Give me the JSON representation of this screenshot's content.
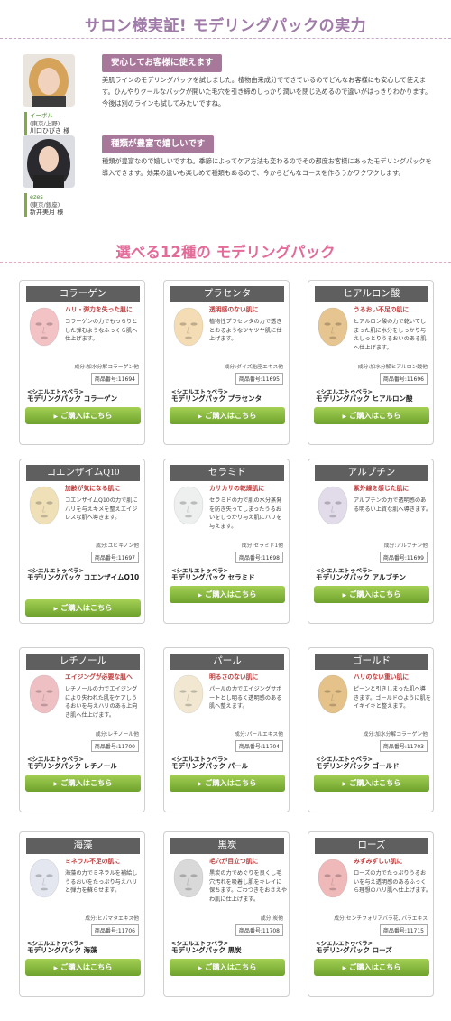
{
  "section_title": "サロン様実証! モデリングパックの実力",
  "reviews": [
    {
      "shop": "イーボル",
      "location": "(東京/上野)",
      "name": "川口ひびき",
      "honorific": "様",
      "tag": "安心してお客様に使えます",
      "text": "美肌ラインのモデリングパックを試しました。植物由来成分でできているのでどんなお客様にも安心して使えます。ひんやりクールなパックが開いた毛穴を引き締めしっかり潤いを閉じ込めるので違いがはっきりわかります。今後は別のラインも試してみたいですね。"
    },
    {
      "shop": "ezes",
      "location": "(東京/銀座)",
      "name": "新井美月",
      "honorific": "様",
      "tag": "種類が豊富で嬉しいです",
      "text": "種類が豊富なので嬉しいですね。季節によってケア方法も変わるのでその都度お客様にあったモデリングパックを導入できます。効果の違いも楽しめて種類もあるので、今からどんなコースを作ろうかワクワクします。"
    }
  ],
  "products_title": "選べる12種の モデリングパック",
  "brand_label": "<シエルエトゥベラ>",
  "buy_label": "ご購入はこちら",
  "products": [
    {
      "name": "コラーゲン",
      "tag": "ハリ・弾力を失った肌に",
      "desc": "コラーゲンの力でもっちりとした弾むようなふっくら肌へ仕上げます。",
      "ingredient": "成分:加水分解コラーゲン他",
      "number": "商品番号:11694",
      "fullname": "モデリングパック コラーゲン",
      "color": "#f2c2c5"
    },
    {
      "name": "プラセンタ",
      "tag": "透明感のない肌に",
      "desc": "植物性プラセンタの力で透きとおるようなツヤツヤ肌に仕上げます。",
      "ingredient": "成分:ダイズ胎座エキス他",
      "number": "商品番号:11695",
      "fullname": "モデリングパック プラセンタ",
      "color": "#f4dcb4"
    },
    {
      "name": "ヒアルロン酸",
      "tag": "うるおい不足の肌に",
      "desc": "ヒアルロン酸の力で乾いてしまった肌に水分をしっかり与えしっとりうるおいのある肌へ仕上げます。",
      "ingredient": "成分:加水分解ヒアルロン酸他",
      "number": "商品番号:11696",
      "fullname": "モデリングパック ヒアルロン酸",
      "color": "#e6c590"
    },
    {
      "name": "コエンザイムQ10",
      "tag": "加齢が気になる肌に",
      "desc": "コエンザイムQ10の力で肌にハリを与えキメを整えエイジレスな肌へ導きます。",
      "ingredient": "成分:ユビキノン他",
      "number": "商品番号:11697",
      "fullname": "モデリングパック コエンザイムQ10",
      "color": "#efe0b8"
    },
    {
      "name": "セラミド",
      "tag": "カサカサの乾燥肌に",
      "desc": "セラミドの力で肌の水分蒸発を防ぎ失ってしまったうるおいをしっかり与え肌にハリを与えます。",
      "ingredient": "成分:セラミド1他",
      "number": "商品番号:11698",
      "fullname": "モデリングパック セラミド",
      "color": "#edf0ef"
    },
    {
      "name": "アルブチン",
      "tag": "紫外線を感じた肌に",
      "desc": "アルブチンの力で透明感のある明るい上質な肌へ導きます。",
      "ingredient": "成分:アルブチン他",
      "number": "商品番号:11699",
      "fullname": "モデリングパック アルブチン",
      "color": "#e2dcea"
    },
    {
      "name": "レチノール",
      "tag": "エイジングが必要な肌へ",
      "desc": "レチノールの力でエイジングにより失われた肌をケアしうるおいを与えハリのある上向き肌へ仕上げます。",
      "ingredient": "成分:レチノール他",
      "number": "商品番号:11700",
      "fullname": "モデリングパック レチノール",
      "color": "#eebfc3"
    },
    {
      "name": "パール",
      "tag": "明るさのない肌に",
      "desc": "パールの力でエイジングサポートとし明るく透明感のある肌へ整えます。",
      "ingredient": "成分:パールエキス他",
      "number": "商品番号:11704",
      "fullname": "モデリングパック パール",
      "color": "#f2e8d2"
    },
    {
      "name": "ゴールド",
      "tag": "ハリのない重い肌に",
      "desc": "ピーンと引きしまった肌へ導きます。ゴールドのように肌をイキイキと整えます。",
      "ingredient": "成分:加水分解コラーゲン他",
      "number": "商品番号:11703",
      "fullname": "モデリングパック ゴールド",
      "color": "#e4c28a"
    },
    {
      "name": "海藻",
      "tag": "ミネラル不足の肌に",
      "desc": "海藻の力でミネラルを補給しうるおいをたっぷり与えハリと弾力を蘇らせます。",
      "ingredient": "成分:ヒバマタエキス他",
      "number": "商品番号:11706",
      "fullname": "モデリングパック 海藻",
      "color": "#e4e6f0"
    },
    {
      "name": "黒炭",
      "tag": "毛穴が目立つ肌に",
      "desc": "黒炭の力でめぐりを良くし毛穴汚れを吸着し肌をキレイに保ちます。ごわつきをおさえやわ肌に仕上げます。",
      "ingredient": "成分:炭他",
      "number": "商品番号:11708",
      "fullname": "モデリングパック 黒炭",
      "color": "#d9d9d9"
    },
    {
      "name": "ローズ",
      "tag": "みずみずしい肌に",
      "desc": "ローズの力でたっぷりうるおいを与え透明感のあるふっくら理想のハリ肌へ仕上げます。",
      "ingredient": "成分:センチフォリアバラ花, バラエキス",
      "number": "商品番号:11715",
      "fullname": "モデリングパック ローズ",
      "color": "#f0b9b9"
    }
  ]
}
